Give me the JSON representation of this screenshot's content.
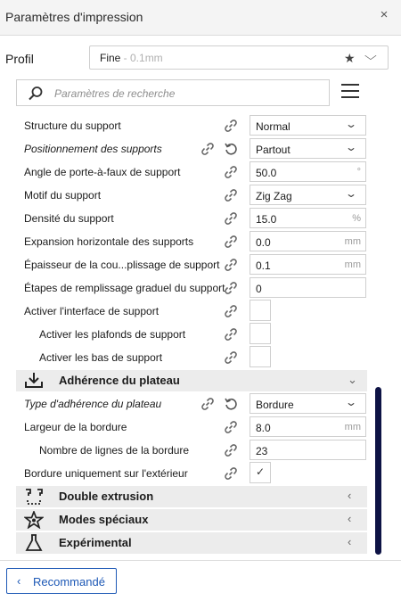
{
  "window": {
    "title": "Paramètres d'impression",
    "close_glyph": "×"
  },
  "profile": {
    "label": "Profil",
    "name": "Fine",
    "detail": " - 0.1mm",
    "star": "★",
    "chevron": "⌵"
  },
  "search": {
    "placeholder": "Paramètres de recherche"
  },
  "rows": [
    {
      "label": "Structure du support",
      "italic": false,
      "indent": false,
      "reset": false,
      "control": "combo",
      "value": "Normal"
    },
    {
      "label": "Positionnement des supports",
      "italic": true,
      "indent": false,
      "reset": true,
      "control": "combo",
      "value": "Partout"
    },
    {
      "label": "Angle de porte-à-faux de support",
      "italic": false,
      "indent": false,
      "reset": false,
      "control": "field",
      "value": "50.0",
      "unit": "°"
    },
    {
      "label": "Motif du support",
      "italic": false,
      "indent": false,
      "reset": false,
      "control": "combo",
      "value": "Zig Zag"
    },
    {
      "label": "Densité du support",
      "italic": false,
      "indent": false,
      "reset": false,
      "control": "field",
      "value": "15.0",
      "unit": "%"
    },
    {
      "label": "Expansion horizontale des supports",
      "italic": false,
      "indent": false,
      "reset": false,
      "control": "field",
      "value": "0.0",
      "unit": "mm"
    },
    {
      "label": "Épaisseur de la cou...plissage de support",
      "italic": false,
      "indent": false,
      "reset": false,
      "control": "field",
      "value": "0.1",
      "unit": "mm"
    },
    {
      "label": "Étapes de remplissage graduel du support",
      "italic": false,
      "indent": false,
      "reset": false,
      "control": "field",
      "value": "0",
      "unit": ""
    },
    {
      "label": "Activer l'interface de support",
      "italic": false,
      "indent": false,
      "reset": false,
      "control": "check",
      "value": ""
    },
    {
      "label": "Activer les plafonds de support",
      "italic": false,
      "indent": true,
      "reset": false,
      "control": "check",
      "value": ""
    },
    {
      "label": "Activer les bas de support",
      "italic": false,
      "indent": true,
      "reset": false,
      "control": "check",
      "value": ""
    }
  ],
  "categories": {
    "adherence": {
      "title": "Adhérence du plateau",
      "icon": "build-plate-adhesion-icon",
      "expanded": true
    },
    "dual": {
      "title": "Double extrusion",
      "icon": "dual-extrusion-icon",
      "expanded": false
    },
    "special": {
      "title": "Modes spéciaux",
      "icon": "special-modes-icon",
      "expanded": false
    },
    "experimental": {
      "title": "Expérimental",
      "icon": "experimental-flask-icon",
      "expanded": false
    }
  },
  "adherence_rows": [
    {
      "label": "Type d'adhérence du plateau",
      "italic": true,
      "indent": false,
      "reset": true,
      "control": "combo",
      "value": "Bordure"
    },
    {
      "label": "Largeur de la bordure",
      "italic": false,
      "indent": false,
      "reset": false,
      "control": "field",
      "value": "8.0",
      "unit": "mm"
    },
    {
      "label": "Nombre de lignes de la bordure",
      "italic": false,
      "indent": true,
      "reset": false,
      "control": "field",
      "value": "23",
      "unit": ""
    },
    {
      "label": "Bordure uniquement sur l'extérieur",
      "italic": false,
      "indent": false,
      "reset": false,
      "control": "check",
      "value": "✓"
    }
  ],
  "footer": {
    "recommended_label": "Recommandé"
  },
  "colors": {
    "accent": "#1e59b6",
    "scrollbar": "#0e1345",
    "category_bg": "#ececec"
  }
}
